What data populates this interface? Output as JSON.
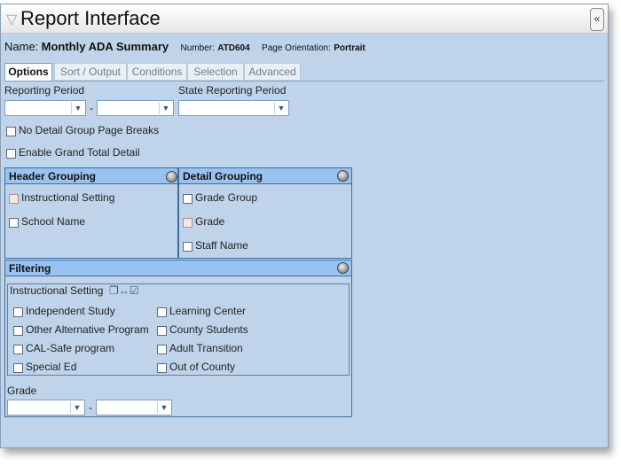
{
  "title": "Report Interface",
  "collapse_glyph": "«",
  "report": {
    "name_label": "Name:",
    "name_value": "Monthly ADA Summary",
    "number_label": "Number:",
    "number_value": "ATD604",
    "orientation_label": "Page Orientation:",
    "orientation_value": "Portrait"
  },
  "tabs": [
    "Options",
    "Sort / Output",
    "Conditions",
    "Selection",
    "Advanced"
  ],
  "options": {
    "reporting_period_label": "Reporting Period",
    "state_reporting_period_label": "State Reporting Period",
    "range_separator": "-",
    "no_detail_breaks": "No Detail Group Page Breaks",
    "enable_grand_total": "Enable Grand Total Detail"
  },
  "header_grouping": {
    "title": "Header Grouping",
    "items": [
      "Instructional Setting",
      "School Name"
    ]
  },
  "detail_grouping": {
    "title": "Detail Grouping",
    "items": [
      "Grade Group",
      "Grade",
      "Staff Name"
    ]
  },
  "filtering": {
    "title": "Filtering",
    "instructional_setting_label": "Instructional Setting",
    "col1": [
      "Independent Study",
      "Other Alternative Program",
      "CAL-Safe program",
      "Special Ed"
    ],
    "col2": [
      "Learning Center",
      "County Students",
      "Adult Transition",
      "Out of County"
    ],
    "grade_label": "Grade",
    "range_separator": "-"
  },
  "icons": {
    "title": "filter-icon",
    "collapse": "double-chevron-left-icon",
    "panel_toggle": "circle-toggle-icon",
    "select_arrow": "chevron-down-icon",
    "instructional_tools": "copy-swap-check-icon"
  }
}
